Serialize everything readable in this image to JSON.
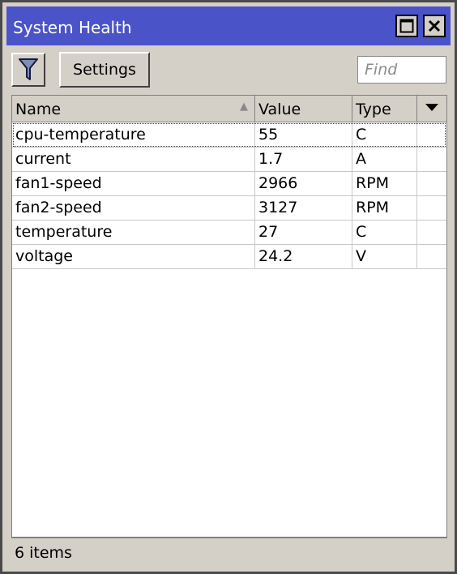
{
  "window": {
    "title": "System Health",
    "maximize_icon": "maximize-icon",
    "close_icon": "close-icon"
  },
  "toolbar": {
    "filter_icon": "filter-icon",
    "settings_label": "Settings",
    "find_placeholder": "Find"
  },
  "table": {
    "columns": [
      "Name",
      "Value",
      "Type"
    ],
    "sort_column": "Name",
    "sort_direction": "ascending",
    "rows": [
      {
        "name": "cpu-temperature",
        "value": "55",
        "type": "C"
      },
      {
        "name": "current",
        "value": "1.7",
        "type": "A"
      },
      {
        "name": "fan1-speed",
        "value": "2966",
        "type": "RPM"
      },
      {
        "name": "fan2-speed",
        "value": "3127",
        "type": "RPM"
      },
      {
        "name": "temperature",
        "value": "27",
        "type": "C"
      },
      {
        "name": "voltage",
        "value": "24.2",
        "type": "V"
      }
    ]
  },
  "status": {
    "items_count": "6 items"
  },
  "colors": {
    "titlebar": "#4b53c8",
    "background": "#d4d0c8"
  }
}
